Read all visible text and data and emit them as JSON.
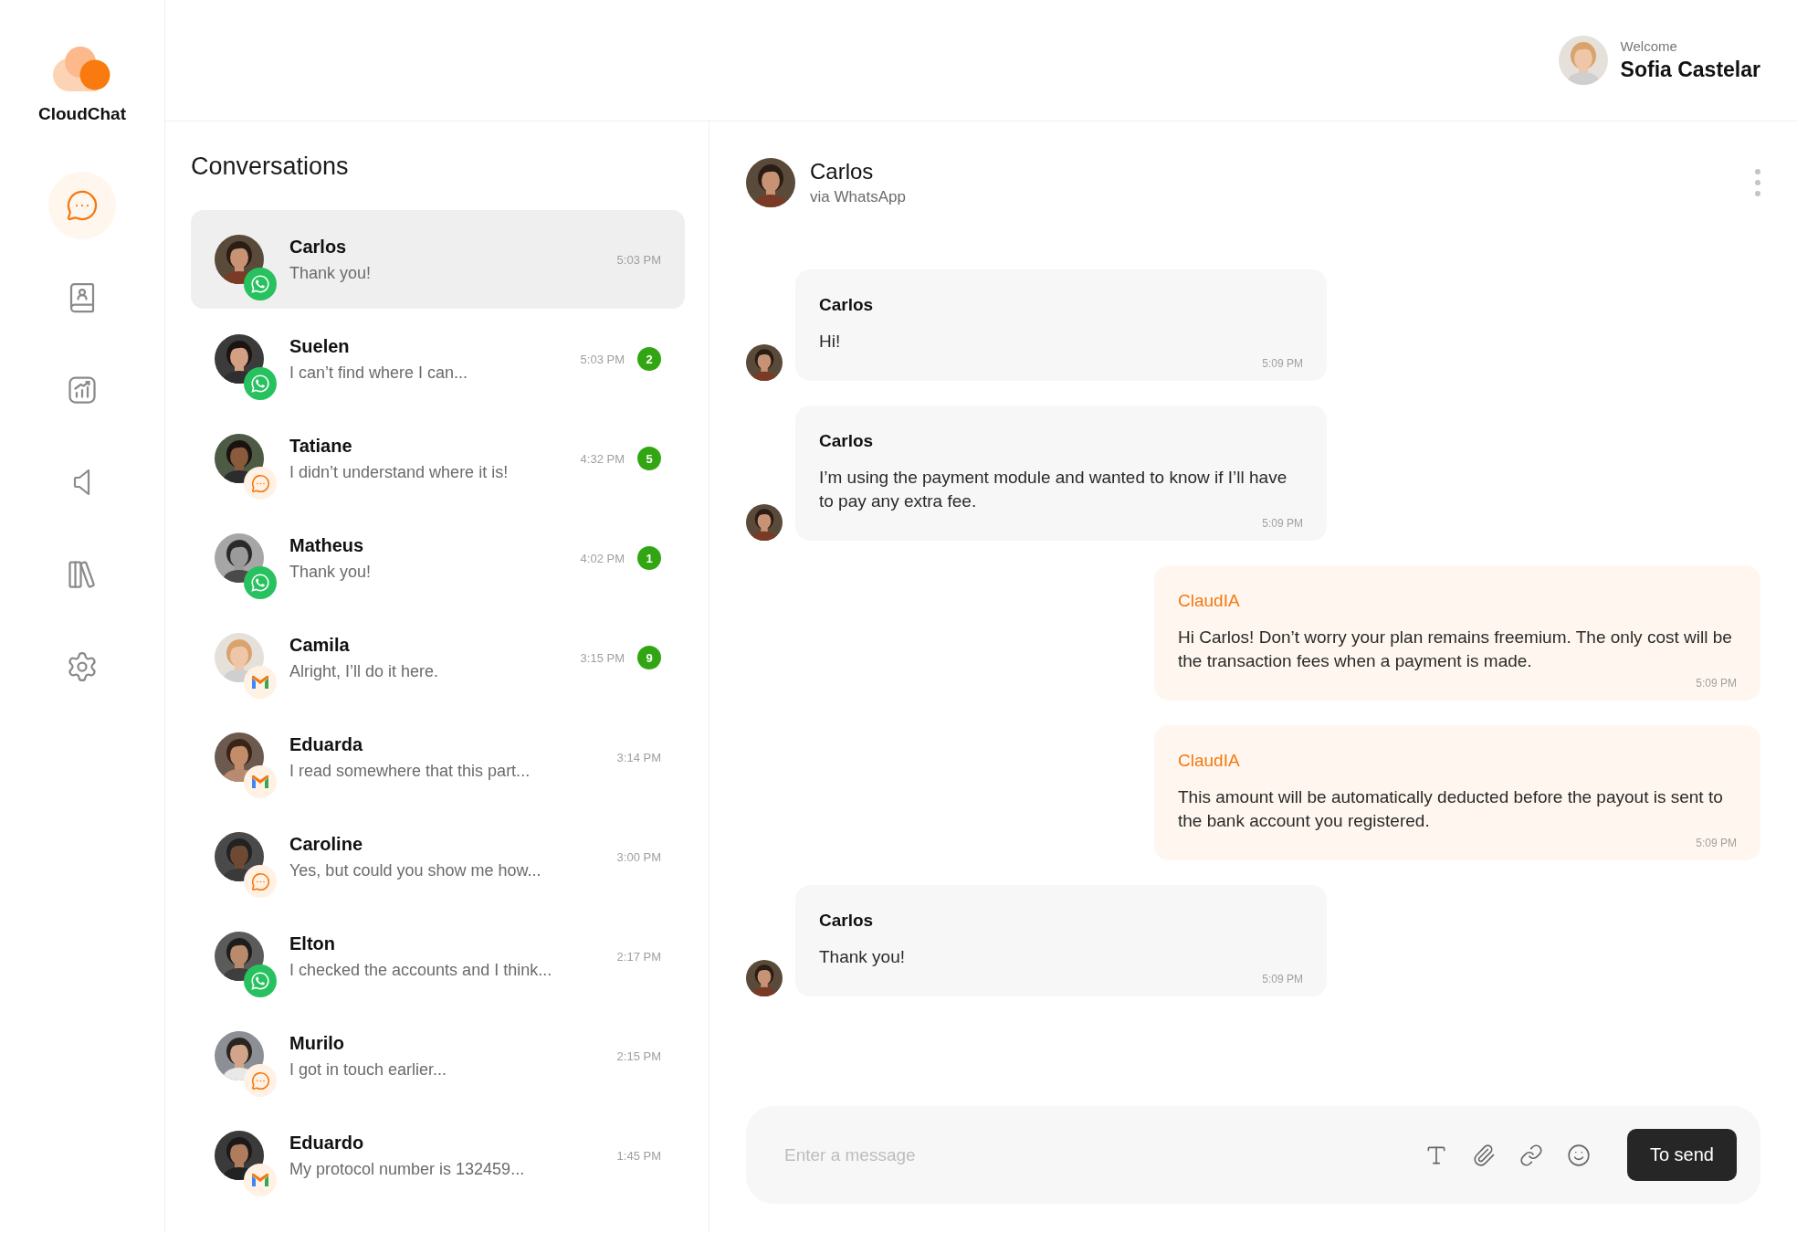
{
  "brand": {
    "name": "CloudChat"
  },
  "nav": [
    {
      "kind": "chat",
      "selected": true
    },
    {
      "kind": "contacts",
      "selected": false
    },
    {
      "kind": "reports",
      "selected": false
    },
    {
      "kind": "campaigns",
      "selected": false
    },
    {
      "kind": "library",
      "selected": false
    },
    {
      "kind": "settings",
      "selected": false
    }
  ],
  "user": {
    "greeting": "Welcome",
    "name": "Sofia Castelar"
  },
  "conversations": {
    "title": "Conversations",
    "items": [
      {
        "name": "Carlos",
        "preview": "Thank you!",
        "time": "5:03 PM",
        "kind": "whatsapp",
        "selected": true
      },
      {
        "name": "Suelen",
        "preview": "I can’t find where I can...",
        "time": "5:03 PM",
        "unread": "2",
        "kind": "whatsapp",
        "selected": false
      },
      {
        "name": "Tatiane",
        "preview": "I didn’t understand where it is!",
        "time": "4:32 PM",
        "unread": "5",
        "kind": "chat",
        "selected": false
      },
      {
        "name": "Matheus",
        "preview": "Thank you!",
        "time": "4:02 PM",
        "unread": "1",
        "kind": "whatsapp",
        "selected": false
      },
      {
        "name": "Camila",
        "preview": "Alright, I’ll do it here.",
        "time": "3:15 PM",
        "unread": "9",
        "kind": "email",
        "selected": false
      },
      {
        "name": "Eduarda",
        "preview": "I read somewhere that this part...",
        "time": "3:14 PM",
        "kind": "email",
        "selected": false
      },
      {
        "name": "Caroline",
        "preview": "Yes, but could you show me how...",
        "time": "3:00 PM",
        "kind": "chat",
        "selected": false
      },
      {
        "name": "Elton",
        "preview": "I checked the accounts and I think...",
        "time": "2:17 PM",
        "kind": "whatsapp",
        "selected": false
      },
      {
        "name": "Murilo",
        "preview": "I got in touch earlier...",
        "time": "2:15 PM",
        "kind": "chat",
        "selected": false
      },
      {
        "name": "Eduardo",
        "preview": "My protocol number is 132459...",
        "time": "1:45 PM",
        "kind": "email",
        "selected": false
      }
    ]
  },
  "chat": {
    "contact": {
      "name": "Carlos",
      "subtitle": "via WhatsApp"
    },
    "messages": [
      {
        "kind": "incoming",
        "sender": "Carlos",
        "text": "Hi!",
        "time": "5:09 PM"
      },
      {
        "kind": "incoming",
        "sender": "Carlos",
        "text": "I’m using the payment module and wanted to know if I’ll have to pay any extra fee.",
        "time": "5:09 PM"
      },
      {
        "kind": "outgoing",
        "sender": "ClaudIA",
        "text": "Hi Carlos! Don’t worry your plan remains freemium. The only cost will be the transaction fees when a payment is made.",
        "time": "5:09 PM"
      },
      {
        "kind": "outgoing",
        "sender": "ClaudIA",
        "text": "This amount will be automatically deducted before the payout is sent to the bank account you registered.",
        "time": "5:09 PM"
      },
      {
        "kind": "incoming",
        "sender": "Carlos",
        "text": "Thank you!",
        "time": "5:09 PM"
      }
    ],
    "composer": {
      "placeholder": "Enter a message",
      "send_label": "To send"
    }
  }
}
